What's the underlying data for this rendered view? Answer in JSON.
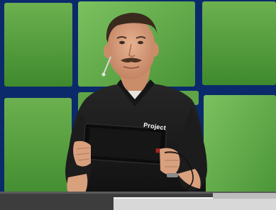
{
  "scene": {
    "description_colors": {
      "panel_green": "#4f9a3a",
      "panel_green_light": "#6fb85a",
      "grid_blue": "#0b2a6b",
      "shirt": "#1b1b1b",
      "skin": "#d9a07e",
      "podium": "#3a3a3a"
    },
    "shirt_logo": "Project"
  }
}
